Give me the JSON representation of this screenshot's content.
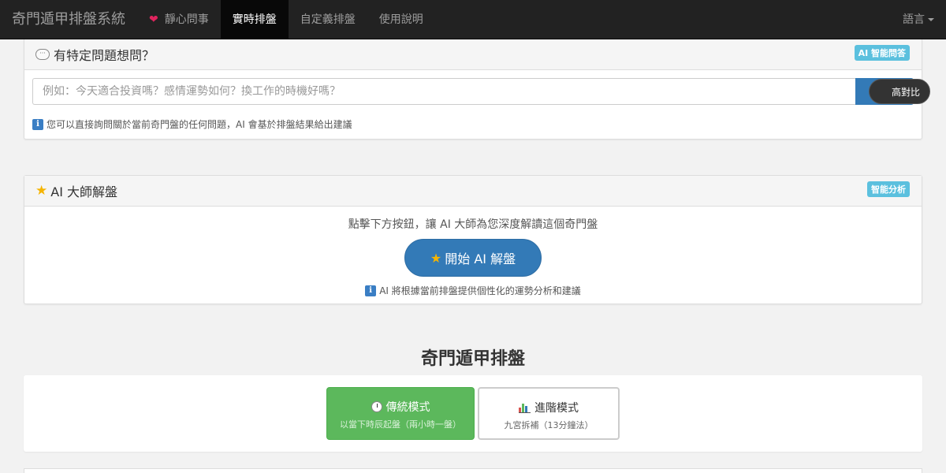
{
  "navbar": {
    "brand": "奇門遁甲排盤系統",
    "items": [
      {
        "label": "靜心問事",
        "icon": "heart-icon",
        "active": false
      },
      {
        "label": "實時排盤",
        "active": true
      },
      {
        "label": "自定義排盤",
        "active": false
      },
      {
        "label": "使用說明",
        "active": false
      }
    ],
    "language": "語言"
  },
  "question_panel": {
    "title": "有特定問題想問？",
    "badge": "AI 智能問答",
    "input_placeholder": "例如：今天適合投資嗎？感情運勢如何？換工作的時機好嗎？",
    "help_text": "您可以直接詢問關於當前奇門盤的任何問題，AI 會基於排盤結果給出建議"
  },
  "contrast_toggle": "高對比",
  "ai_panel": {
    "title": "AI 大師解盤",
    "badge": "智能分析",
    "description": "點擊下方按鈕，讓 AI 大師為您深度解讀這個奇門盤",
    "button_label": "開始 AI 解盤",
    "note": "AI 將根據當前排盤提供個性化的運勢分析和建議"
  },
  "section": {
    "title": "奇門遁甲排盤"
  },
  "modes": [
    {
      "title": "傳統模式",
      "subtitle": "以當下時辰起盤（兩小時一盤）",
      "icon": "clock-icon",
      "selected": true
    },
    {
      "title": "進階模式",
      "subtitle": "九宮拆補（13分鐘法）",
      "icon": "bar-chart-icon",
      "selected": false
    }
  ],
  "colors": {
    "navbar_bg": "#222222",
    "primary": "#337ab7",
    "success": "#5cb85c",
    "info_badge": "#5bc0de"
  }
}
